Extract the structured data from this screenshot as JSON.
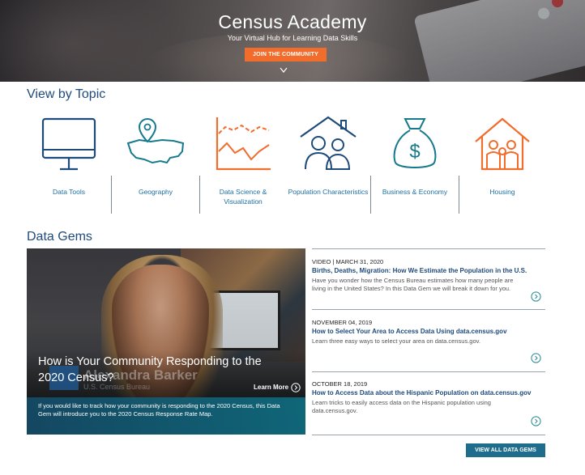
{
  "hero": {
    "title": "Census Academy",
    "subtitle": "Your Virtual Hub for Learning Data Skills",
    "join_label": "JOIN THE COMMUNITY",
    "scroll_icon": "chevron-down-icon"
  },
  "topics": {
    "heading": "View by Topic",
    "items": [
      {
        "label": "Data Tools",
        "icon": "monitor-icon"
      },
      {
        "label": "Geography",
        "icon": "map-pin-icon"
      },
      {
        "label": "Data Science & Visualization",
        "icon": "line-chart-icon"
      },
      {
        "label": "Population Characteristics",
        "icon": "family-house-icon"
      },
      {
        "label": "Business & Economy",
        "icon": "money-bag-icon"
      },
      {
        "label": "Housing",
        "icon": "house-family-icon"
      }
    ]
  },
  "gems": {
    "heading": "Data Gems",
    "feature": {
      "title": "How is Your Community Responding to the 2020 Census?",
      "learn_more": "Learn More",
      "description": "If you would like to track how your community is responding to the 2020 Census, this Data Gem will introduce you to the 2020 Census Response Rate Map.",
      "name_overlay": "Alexandra Barker",
      "org_overlay": "U.S. Census Bureau"
    },
    "list": [
      {
        "meta": "VIDEO | MARCH 31, 2020",
        "title": "Births, Deaths, Migration: How We Estimate the Population in the U.S.",
        "text": "Have you wonder how the Census Bureau estimates how many people are living in the United States? In this Data Gem we will break it down for you."
      },
      {
        "meta": "NOVEMBER 04, 2019",
        "title": "How to Select Your Area to Access Data Using data.census.gov",
        "text": "Learn three easy ways to select your area on data.census.gov."
      },
      {
        "meta": "OCTOBER 18, 2019",
        "title": "How to Access Data about the Hispanic Population on data.census.gov",
        "text": "Learn tricks to easily access data on the Hispanic population using data.census.gov."
      }
    ],
    "view_all": "VIEW ALL DATA GEMS"
  },
  "colors": {
    "navy": "#1f4b7a",
    "teal": "#167a8c",
    "orange": "#f26c2c"
  }
}
